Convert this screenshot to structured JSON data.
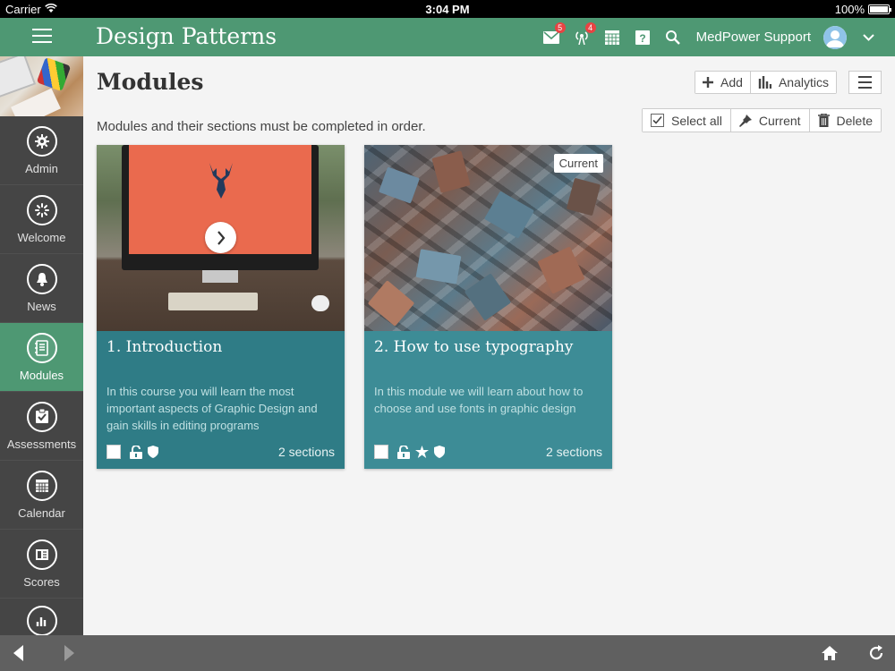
{
  "status_bar": {
    "carrier": "Carrier",
    "time": "3:04 PM",
    "battery": "100%"
  },
  "header": {
    "title": "Design Patterns",
    "mail_badge": "5",
    "alerts_badge": "4",
    "user_name": "MedPower Support"
  },
  "sidebar": {
    "items": [
      {
        "label": "Admin"
      },
      {
        "label": "Welcome"
      },
      {
        "label": "News"
      },
      {
        "label": "Modules"
      },
      {
        "label": "Assessments"
      },
      {
        "label": "Calendar"
      },
      {
        "label": "Scores"
      }
    ]
  },
  "main": {
    "title": "Modules",
    "add_label": "Add",
    "analytics_label": "Analytics",
    "subtitle": "Modules and their sections must be completed in order.",
    "select_all_label": "Select all",
    "current_label": "Current",
    "delete_label": "Delete"
  },
  "modules": [
    {
      "title": "1. Introduction",
      "description": "In this course you will learn the most important aspects of Graphic Design and gain skills in editing programs",
      "sections": "2 sections"
    },
    {
      "title": "2. How to use typography",
      "description": "In this module we will learn about how to choose and use fonts in graphic design",
      "sections": "2 sections",
      "tag": "Current"
    }
  ],
  "colors": {
    "primary": "#4e9873",
    "card": "#2f7c86",
    "sidebar": "#454545"
  }
}
